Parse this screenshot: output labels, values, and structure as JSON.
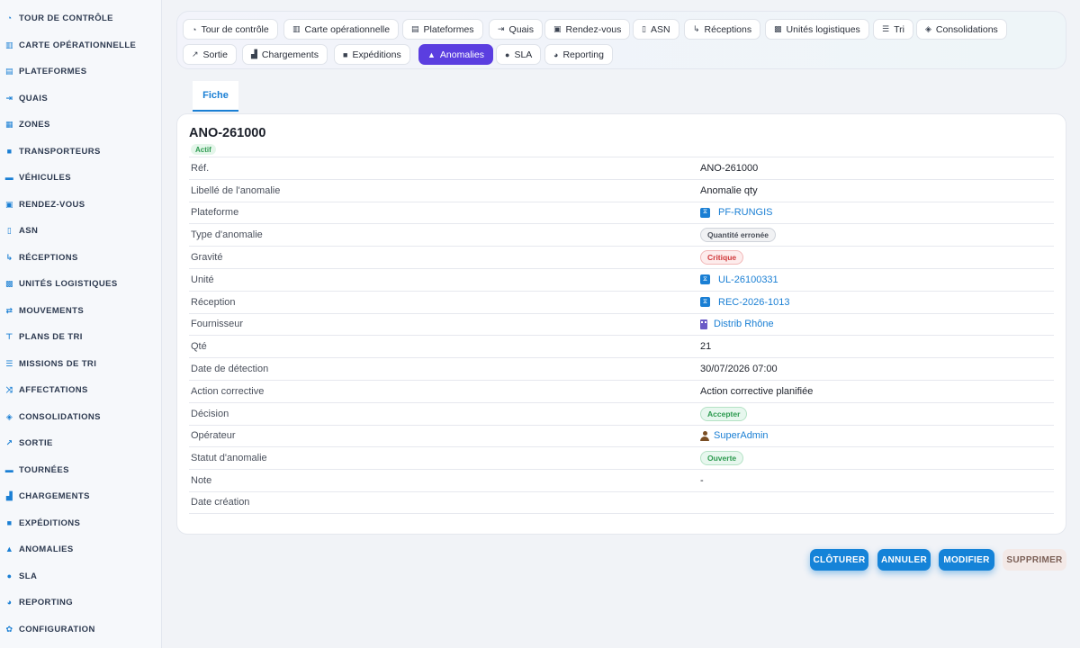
{
  "sidebar": {
    "items": [
      {
        "label": "TOUR DE CONTRÔLE",
        "icon": "gauge-icon"
      },
      {
        "label": "CARTE OPÉRATIONNELLE",
        "icon": "map-icon"
      },
      {
        "label": "PLATEFORMES",
        "icon": "warehouse-icon"
      },
      {
        "label": "QUAIS",
        "icon": "dock-icon"
      },
      {
        "label": "ZONES",
        "icon": "grid-icon"
      },
      {
        "label": "TRANSPORTEURS",
        "icon": "truck-icon"
      },
      {
        "label": "VÉHICULES",
        "icon": "vehicle-icon"
      },
      {
        "label": "RENDEZ-VOUS",
        "icon": "calendar-icon"
      },
      {
        "label": "ASN",
        "icon": "file-icon"
      },
      {
        "label": "RÉCEPTIONS",
        "icon": "dolly-icon"
      },
      {
        "label": "UNITÉS LOGISTIQUES",
        "icon": "pallet-icon"
      },
      {
        "label": "MOUVEMENTS",
        "icon": "arrows-icon"
      },
      {
        "label": "PLANS DE TRI",
        "icon": "sitemap-icon"
      },
      {
        "label": "MISSIONS DE TRI",
        "icon": "list-icon"
      },
      {
        "label": "AFFECTATIONS",
        "icon": "shuffle-icon"
      },
      {
        "label": "CONSOLIDATIONS",
        "icon": "layers-icon"
      },
      {
        "label": "SORTIE",
        "icon": "exit-icon"
      },
      {
        "label": "TOURNÉES",
        "icon": "route-icon"
      },
      {
        "label": "CHARGEMENTS",
        "icon": "loading-icon"
      },
      {
        "label": "EXPÉDITIONS",
        "icon": "shipping-icon"
      },
      {
        "label": "ANOMALIES",
        "icon": "warning-icon"
      },
      {
        "label": "SLA",
        "icon": "stopwatch-icon"
      },
      {
        "label": "REPORTING",
        "icon": "pie-chart-icon"
      },
      {
        "label": "CONFIGURATION",
        "icon": "gear-icon"
      }
    ]
  },
  "topnav": {
    "tabs": [
      {
        "label": "Tour de contrôle",
        "icon": "gauge-icon",
        "active": false
      },
      {
        "label": "Carte opérationnelle",
        "icon": "map-icon",
        "active": false
      },
      {
        "label": "Plateformes",
        "icon": "warehouse-icon",
        "active": false
      },
      {
        "label": "Quais",
        "icon": "dock-icon",
        "active": false
      },
      {
        "label": "Rendez-vous",
        "icon": "calendar-icon",
        "active": false
      },
      {
        "label": "ASN",
        "icon": "file-icon",
        "active": false
      },
      {
        "label": "Réceptions",
        "icon": "dolly-icon",
        "active": false
      },
      {
        "label": "Unités logistiques",
        "icon": "pallet-icon",
        "active": false
      },
      {
        "label": "Tri",
        "icon": "list-icon",
        "active": false
      },
      {
        "label": "Consolidations",
        "icon": "layers-icon",
        "active": false
      },
      {
        "label": "Sortie",
        "icon": "exit-icon",
        "active": false
      },
      {
        "label": "Chargements",
        "icon": "loading-icon",
        "active": false
      },
      {
        "label": "Expéditions",
        "icon": "shipping-icon",
        "active": false
      },
      {
        "label": "Anomalies",
        "icon": "warning-icon",
        "active": true
      },
      {
        "label": "SLA",
        "icon": "stopwatch-icon",
        "active": false
      },
      {
        "label": "Reporting",
        "icon": "pie-chart-icon",
        "active": false
      }
    ]
  },
  "detail": {
    "tab_label": "Fiche",
    "title": "ANO-261000",
    "status": "Actif",
    "fields": {
      "ref": {
        "label": "Réf.",
        "value": "ANO-261000"
      },
      "libelle": {
        "label": "Libellé de l'anomalie",
        "value": "Anomalie qty"
      },
      "plateforme": {
        "label": "Plateforme",
        "value": "PF-RUNGIS"
      },
      "type": {
        "label": "Type d'anomalie",
        "value": "Quantité erronée"
      },
      "gravite": {
        "label": "Gravité",
        "value": "Critique"
      },
      "unite": {
        "label": "Unité",
        "value": "UL-26100331"
      },
      "reception": {
        "label": "Réception",
        "value": "REC-2026-1013"
      },
      "fournisseur": {
        "label": "Fournisseur",
        "value": "Distrib Rhône"
      },
      "qte": {
        "label": "Qté",
        "value": "21"
      },
      "date_detection": {
        "label": "Date de détection",
        "value": "30/07/2026 07:00"
      },
      "action": {
        "label": "Action corrective",
        "value": "Action corrective planifiée"
      },
      "decision": {
        "label": "Décision",
        "value": "Accepter"
      },
      "operateur": {
        "label": "Opérateur",
        "value": "SuperAdmin"
      },
      "statut": {
        "label": "Statut d'anomalie",
        "value": "Ouverte"
      },
      "note": {
        "label": "Note",
        "value": "-"
      },
      "date_creation": {
        "label": "Date création",
        "value": ""
      }
    }
  },
  "actions": {
    "cloturer": "CLÔTURER",
    "annuler": "ANNULER",
    "modifier": "MODIFIER",
    "supprimer": "SUPPRIMER"
  },
  "colors": {
    "accent": "#1a7fd4",
    "active_tab": "#5b3ee0",
    "critical": "#d0393b",
    "success": "#2c9a4f"
  }
}
